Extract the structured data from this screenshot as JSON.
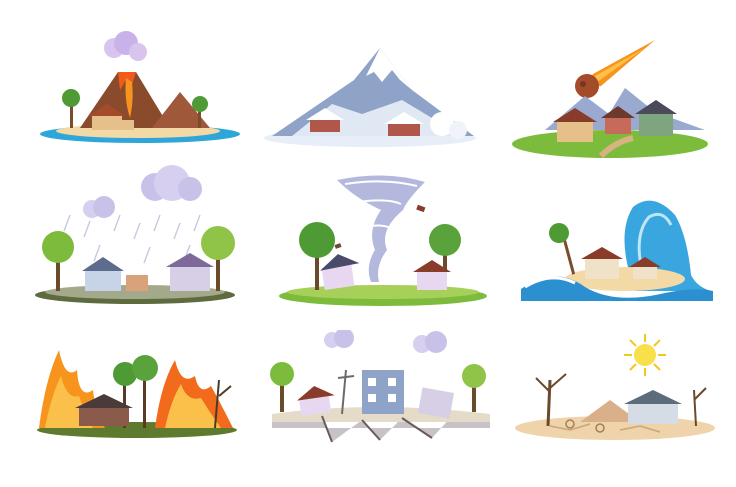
{
  "title": "",
  "colors": {
    "background": "#ffffff",
    "sea": "#2fa6d9",
    "sand": "#f3d9a6",
    "grass": "#7dbb3c",
    "lava": "#f05a1a",
    "fire": "#f7941d",
    "snow": "#e7eef7",
    "mountain": "#8ea3c7",
    "sky_cloud": "#c9c2e8",
    "house_wall": "#b9a9d6",
    "roof": "#8a3c2a",
    "dry_ground": "#efd3aa",
    "sun": "#f7e04a"
  },
  "scenes": [
    {
      "name": "volcano-island",
      "icon": "volcano-icon"
    },
    {
      "name": "avalanche",
      "icon": "snow-mountain-icon"
    },
    {
      "name": "meteor",
      "icon": "meteor-icon"
    },
    {
      "name": "storm-rain",
      "icon": "rain-cloud-icon"
    },
    {
      "name": "tornado",
      "icon": "tornado-icon"
    },
    {
      "name": "tsunami",
      "icon": "wave-icon"
    },
    {
      "name": "wildfire",
      "icon": "fire-icon"
    },
    {
      "name": "earthquake",
      "icon": "crack-icon"
    },
    {
      "name": "drought",
      "icon": "sun-icon"
    }
  ]
}
